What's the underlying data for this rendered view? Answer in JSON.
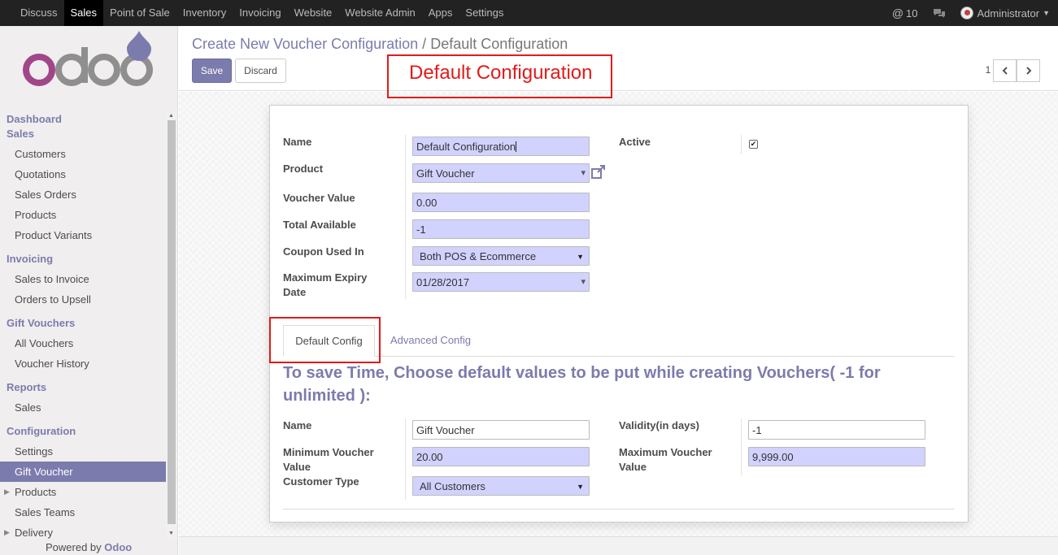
{
  "topbar": {
    "menu": [
      "Discuss",
      "Sales",
      "Point of Sale",
      "Inventory",
      "Invoicing",
      "Website",
      "Website Admin",
      "Apps",
      "Settings"
    ],
    "active_menu": "Sales",
    "notifications": "10",
    "user": "Administrator"
  },
  "sidebar": {
    "dashboard": "Dashboard",
    "sales_head": "Sales",
    "sales_items": [
      "Customers",
      "Quotations",
      "Sales Orders",
      "Products",
      "Product Variants"
    ],
    "invoicing_head": "Invoicing",
    "invoicing_items": [
      "Sales to Invoice",
      "Orders to Upsell"
    ],
    "gift_head": "Gift Vouchers",
    "gift_items": [
      "All Vouchers",
      "Voucher History"
    ],
    "reports_head": "Reports",
    "reports_items": [
      "Sales"
    ],
    "config_head": "Configuration",
    "config_items": [
      "Settings",
      "Gift Voucher",
      "Products",
      "Sales Teams",
      "Delivery"
    ],
    "powered_prefix": "Powered by",
    "powered_brand": "Odoo"
  },
  "control": {
    "breadcrumb_parent": "Create New Voucher Configuration",
    "breadcrumb_sep": "/",
    "breadcrumb_current": "Default Configuration",
    "save_label": "Save",
    "discard_label": "Discard",
    "pager": "1 / 1"
  },
  "annotation": {
    "callout_text": "Default Configuration"
  },
  "form": {
    "name_label": "Name",
    "name_value": "Default Configuration",
    "product_label": "Product",
    "product_value": "Gift Voucher",
    "voucher_value_label": "Voucher Value",
    "voucher_value": "0.00",
    "total_available_label": "Total Available",
    "total_available": "-1",
    "coupon_used_label": "Coupon Used In",
    "coupon_used": "Both POS & Ecommerce",
    "max_expiry_label_1": "Maximum Expiry",
    "max_expiry_label_2": "Date",
    "max_expiry": "01/28/2017",
    "active_label": "Active",
    "active_checked": true
  },
  "tabs": {
    "default": "Default Config",
    "advanced": "Advanced Config"
  },
  "defaults": {
    "heading": "To save Time, Choose default values to be put while creating Vouchers( -1 for unlimited ):",
    "name_label": "Name",
    "name_value": "Gift Voucher",
    "min_voucher_label_1": "Minimum Voucher",
    "min_voucher_label_2": "Value",
    "min_voucher": "20.00",
    "customer_type_label": "Customer Type",
    "customer_type": "All Customers",
    "validity_label": "Validity(in days)",
    "validity": "-1",
    "max_voucher_label_1": "Maximum Voucher",
    "max_voucher_label_2": "Value",
    "max_voucher": "9,999.00"
  },
  "colors": {
    "accent": "#7c7bad",
    "required_bg": "#d2d2ff",
    "highlight": "#e21b1b"
  }
}
